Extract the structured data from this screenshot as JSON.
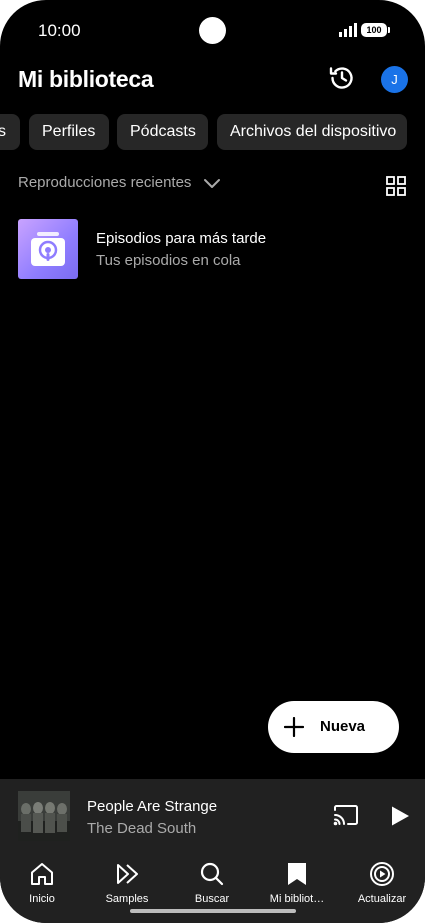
{
  "status_bar": {
    "time": "10:00",
    "battery": "100"
  },
  "header": {
    "title": "Mi biblioteca",
    "avatar_letter": "J"
  },
  "chips": [
    {
      "label": "s"
    },
    {
      "label": "Perfiles"
    },
    {
      "label": "Pódcasts"
    },
    {
      "label": "Archivos del dispositivo"
    }
  ],
  "sort": {
    "label": "Reproducciones recientes"
  },
  "library_items": [
    {
      "title": "Episodios para más tarde",
      "subtitle": "Tus episodios en cola"
    }
  ],
  "fab": {
    "label": "Nueva"
  },
  "now_playing": {
    "title": "People Are Strange",
    "artist": "The Dead South"
  },
  "nav": [
    {
      "label": "Inicio",
      "icon": "home-icon"
    },
    {
      "label": "Samples",
      "icon": "samples-icon"
    },
    {
      "label": "Buscar",
      "icon": "search-icon"
    },
    {
      "label": "Mi bibliot…",
      "icon": "library-icon"
    },
    {
      "label": "Actualizar",
      "icon": "upgrade-icon"
    }
  ]
}
